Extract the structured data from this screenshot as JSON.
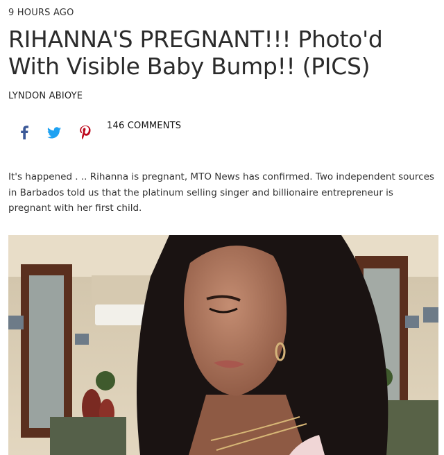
{
  "article": {
    "timestamp": "9 HOURS AGO",
    "headline": "RIHANNA'S PREGNANT!!! Photo'd With Visible Baby Bump!! (PICS)",
    "author": "LYNDON ABIOYE",
    "comments": "146 COMMENTS",
    "body": "It's happened . .. Rihanna is pregnant, MTO News has confirmed. Two independent sources in Barbados told us that the platinum selling singer and billionaire entrepreneur is pregnant with her first child."
  },
  "share": {
    "icons": [
      "facebook-icon",
      "twitter-icon",
      "pinterest-icon"
    ],
    "colors": {
      "facebook": "#3b5998",
      "twitter": "#1da1f2",
      "pinterest": "#bd081c"
    }
  },
  "photo": {
    "subject": "Rihanna",
    "colors": {
      "wall": "#d9cdb6",
      "mirror_frame": "#5a2f1e",
      "hair": "#1a1312",
      "skin": "#a9725a"
    }
  }
}
